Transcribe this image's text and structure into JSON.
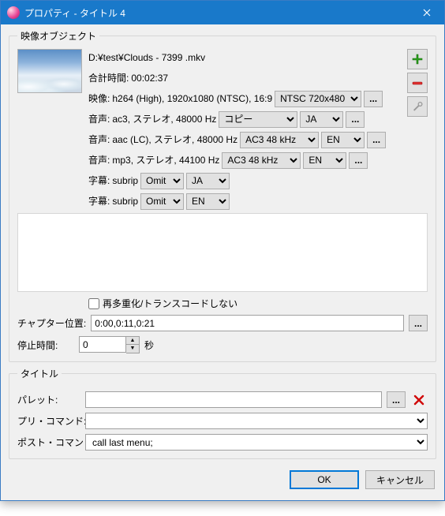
{
  "window": {
    "title": "プロパティ - タイトル 4"
  },
  "group_video": {
    "legend": "映像オブジェクト"
  },
  "file": {
    "path": "D:¥test¥Clouds - 7399 .mkv",
    "total_label": "合計時間:",
    "total_time": "00:02:37"
  },
  "video": {
    "prefix": "映像:",
    "info": "h264 (High), 1920x1080 (NTSC), 16:9",
    "format_options": [
      "NTSC 720x480"
    ],
    "format_value": "NTSC 720x480"
  },
  "audio1": {
    "prefix": "音声:",
    "info": "ac3, ステレオ, 48000 Hz",
    "enc_options": [
      "コピー"
    ],
    "enc_value": "コピー",
    "lang_options": [
      "JA"
    ],
    "lang_value": "JA"
  },
  "audio2": {
    "prefix": "音声:",
    "info": "aac (LC), ステレオ, 48000 Hz",
    "enc_options": [
      "AC3 48 kHz"
    ],
    "enc_value": "AC3 48 kHz",
    "lang_options": [
      "EN"
    ],
    "lang_value": "EN"
  },
  "audio3": {
    "prefix": "音声:",
    "info": "mp3, ステレオ, 44100 Hz",
    "enc_options": [
      "AC3 48 kHz"
    ],
    "enc_value": "AC3 48 kHz",
    "lang_options": [
      "EN"
    ],
    "lang_value": "EN"
  },
  "sub1": {
    "prefix": "字幕:",
    "info": "subrip",
    "action_options": [
      "Omit"
    ],
    "action_value": "Omit",
    "lang_options": [
      "JA"
    ],
    "lang_value": "JA"
  },
  "sub2": {
    "prefix": "字幕:",
    "info": "subrip",
    "action_options": [
      "Omit"
    ],
    "action_value": "Omit",
    "lang_options": [
      "EN"
    ],
    "lang_value": "EN"
  },
  "remux": {
    "label": "再多重化/トランスコードしない"
  },
  "chapter": {
    "label": "チャプター位置:",
    "value": "0:00,0:11,0:21"
  },
  "pause": {
    "label": "停止時間:",
    "value": "0",
    "unit": "秒"
  },
  "group_title": {
    "legend": "タイトル"
  },
  "palette": {
    "label": "パレット:",
    "value": ""
  },
  "precmd": {
    "label": "プリ・コマンド:",
    "value": ""
  },
  "postcmd": {
    "label": "ポスト・コマンド:",
    "value": "call last menu;"
  },
  "buttons": {
    "ok": "OK",
    "cancel": "キャンセル",
    "dots": "..."
  },
  "icons": {
    "plus_color": "#2aa11a",
    "minus_color": "#d22",
    "wrench_color": "#8a8a8a"
  }
}
